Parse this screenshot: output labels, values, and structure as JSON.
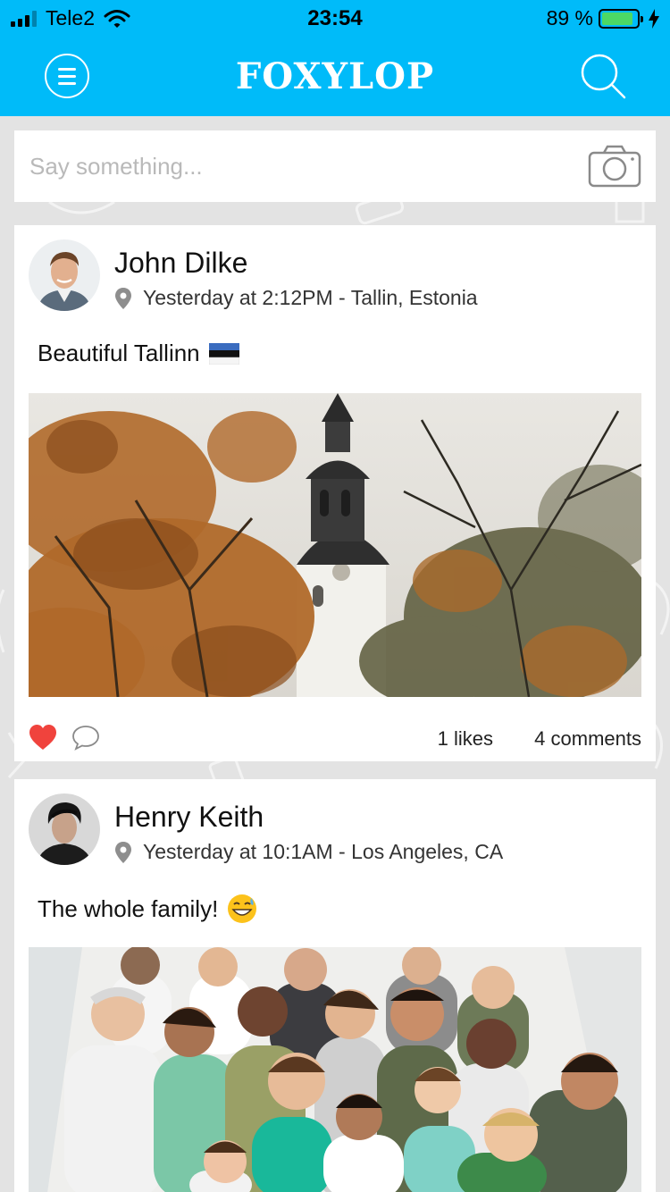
{
  "status_bar": {
    "carrier": "Tele2",
    "time": "23:54",
    "battery_percent": "89 %",
    "battery_level": 0.89
  },
  "navbar": {
    "logo_text": "FOXYLOP",
    "menu_icon": "hamburger-menu-icon",
    "search_icon": "search-icon"
  },
  "composer": {
    "placeholder": "Say something...",
    "camera_icon": "camera-icon"
  },
  "posts": [
    {
      "author": "John Dilke",
      "meta": "Yesterday at 2:12PM - Tallin, Estonia",
      "text": "Beautiful Tallinn",
      "emoji": "flag-estonia",
      "likes": "1 likes",
      "comments": "4 comments",
      "liked": true
    },
    {
      "author": "Henry Keith",
      "meta": "Yesterday at 10:1AM - Los Angeles, CA",
      "text": "The whole family!",
      "emoji": "grinning-sweat-face"
    }
  ],
  "colors": {
    "brand": "#00bbf9",
    "like": "#f0433d",
    "background": "#e3e3e3"
  }
}
